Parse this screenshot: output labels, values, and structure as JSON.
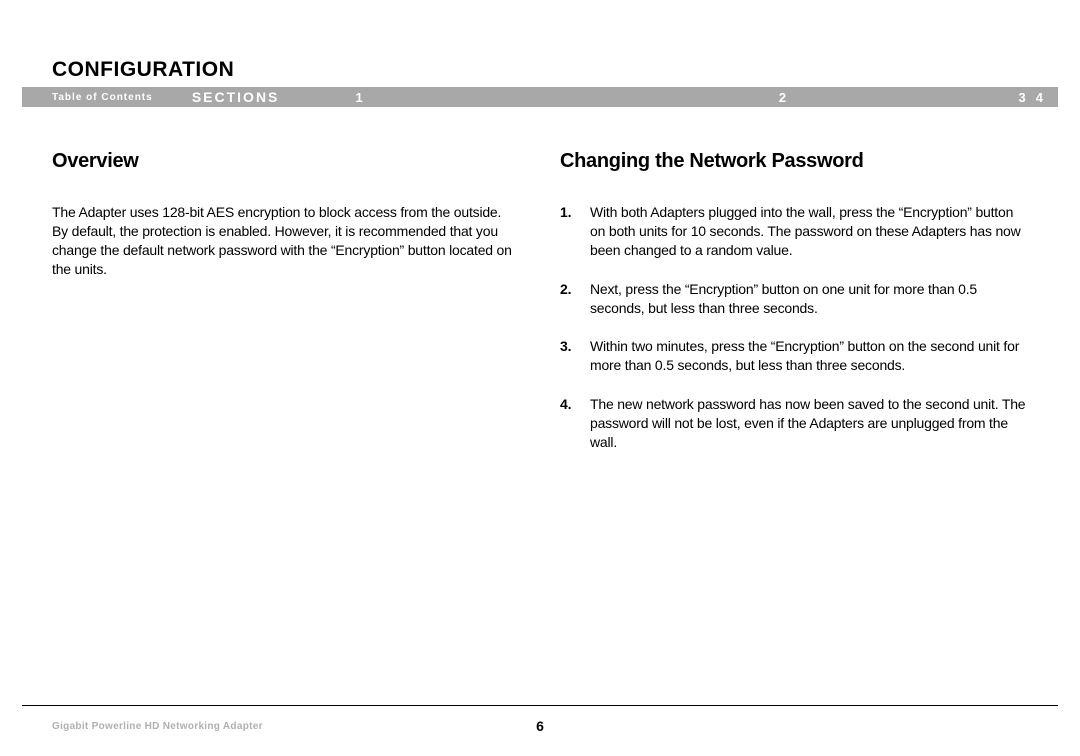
{
  "header": {
    "title": "CONFIGURATION"
  },
  "nav": {
    "toc": "Table of Contents",
    "sections": "SECTIONS",
    "n1": "1",
    "n2": "2",
    "n3": "3",
    "n4": "4"
  },
  "left": {
    "heading": "Overview",
    "body": "The Adapter uses 128-bit AES encryption to block access from the outside. By default, the protection is enabled. However, it is recommended that you change the default network password with the “Encryption” button located on the units."
  },
  "right": {
    "heading": "Changing the Network Password",
    "steps": [
      "With both Adapters plugged into the wall, press the “Encryption” button on both units for 10 seconds. The password on these Adapters has now been changed to a random value.",
      "Next, press the “Encryption” button on one unit for more than 0.5 seconds, but less than three seconds.",
      "Within two minutes, press the “Encryption” button on the second unit for more than 0.5 seconds, but less than three seconds.",
      "The new network password has now been saved to the second unit. The password will not be lost, even if the Adapters are unplugged from the wall."
    ]
  },
  "footer": {
    "product": "Gigabit Powerline HD Networking Adapter",
    "page": "6"
  }
}
